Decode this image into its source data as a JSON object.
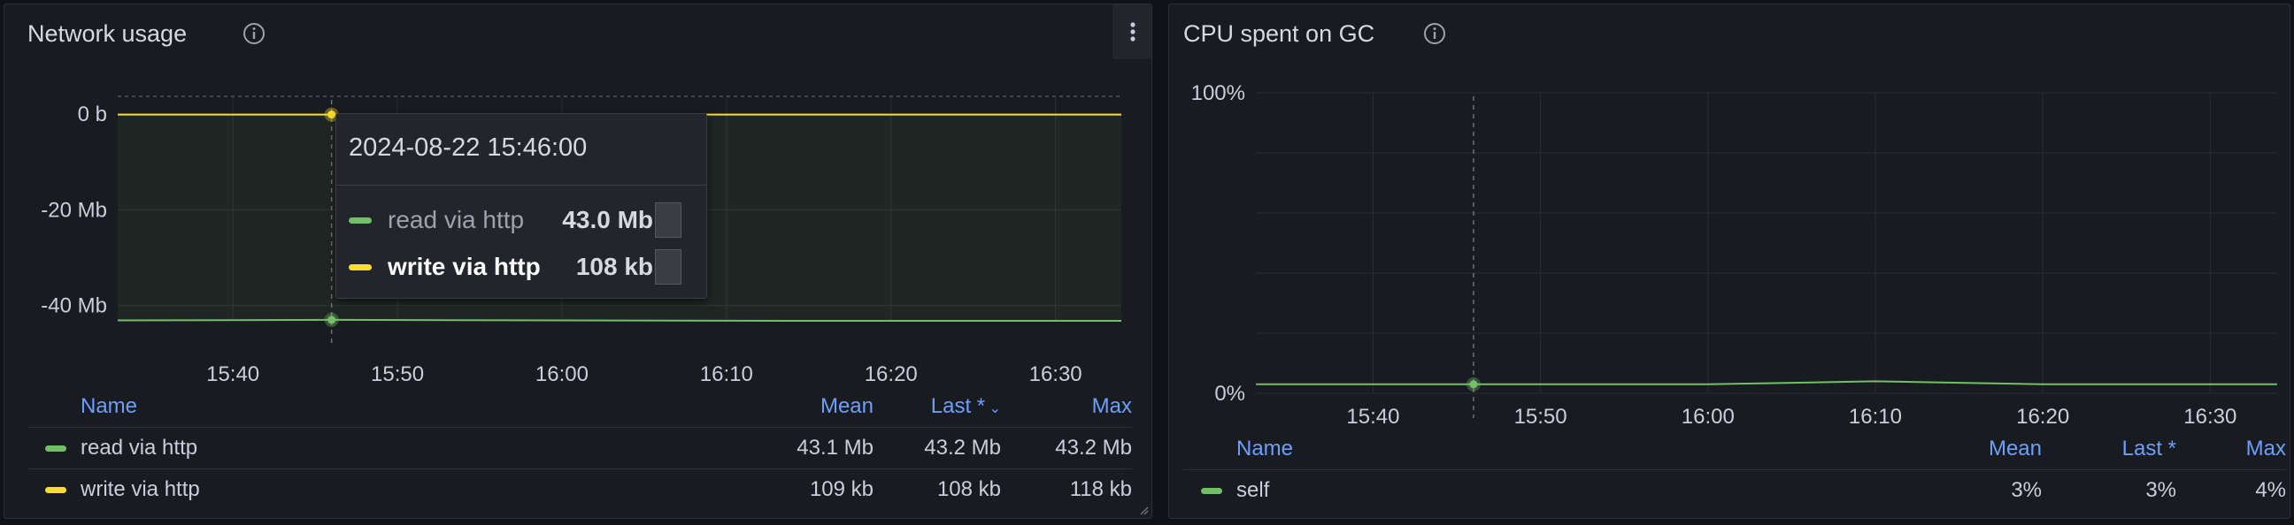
{
  "colors": {
    "read": "#73bf69",
    "write": "#fade2a",
    "self": "#73bf69",
    "header": "#6e9fff"
  },
  "network_panel": {
    "title": "Network usage",
    "legend": {
      "headers": {
        "name": "Name",
        "mean": "Mean",
        "last": "Last *",
        "max": "Max"
      },
      "rows": [
        {
          "name": "read via http",
          "mean": "43.1 Mb",
          "last": "43.2 Mb",
          "max": "43.2 Mb"
        },
        {
          "name": "write via http",
          "mean": "109 kb",
          "last": "108 kb",
          "max": "118 kb"
        }
      ]
    },
    "tooltip": {
      "time": "2024-08-22 15:46:00",
      "rows": [
        {
          "name": "read via http",
          "value": "43.0 Mb"
        },
        {
          "name": "write via http",
          "value": "108 kb"
        }
      ]
    }
  },
  "cpu_panel": {
    "title": "CPU spent on GC",
    "legend": {
      "headers": {
        "name": "Name",
        "mean": "Mean",
        "last": "Last *",
        "max": "Max"
      },
      "rows": [
        {
          "name": "self",
          "mean": "3%",
          "last": "3%",
          "max": "4%"
        }
      ]
    }
  },
  "chart_data": [
    {
      "type": "line",
      "title": "Network usage",
      "x_unit": "time",
      "xticks": [
        "15:40",
        "15:50",
        "16:00",
        "16:10",
        "16:20",
        "16:30"
      ],
      "x_range": [
        "15:33",
        "16:34"
      ],
      "yticks": [
        "0 b",
        "-20 Mb",
        "-40 Mb"
      ],
      "ylim": [
        -43.2,
        0
      ],
      "series": [
        {
          "name": "read via http",
          "x": [
            "15:33",
            "15:46",
            "16:00",
            "16:15",
            "16:34"
          ],
          "y": [
            -43.1,
            -43.0,
            -43.1,
            -43.2,
            -43.2
          ]
        },
        {
          "name": "write via http",
          "x": [
            "15:33",
            "15:46",
            "16:00",
            "16:15",
            "16:34"
          ],
          "y": [
            -0.109,
            -0.108,
            -0.109,
            -0.11,
            -0.108
          ]
        }
      ],
      "crosshair_x": "15:46",
      "grid": true,
      "legend": "bottom"
    },
    {
      "type": "line",
      "title": "CPU spent on GC",
      "xticks": [
        "15:40",
        "15:50",
        "16:00",
        "16:10",
        "16:20",
        "16:30"
      ],
      "x_range": [
        "15:33",
        "16:34"
      ],
      "yticks": [
        "100%",
        "0%"
      ],
      "ylim": [
        0,
        100
      ],
      "series": [
        {
          "name": "self",
          "x": [
            "15:33",
            "15:40",
            "15:46",
            "15:50",
            "16:00",
            "16:10",
            "16:20",
            "16:30",
            "16:34"
          ],
          "y": [
            3,
            3,
            3,
            3,
            3,
            4,
            3,
            3,
            3
          ]
        }
      ],
      "crosshair_x": "15:46",
      "grid": true,
      "legend": "bottom"
    }
  ]
}
